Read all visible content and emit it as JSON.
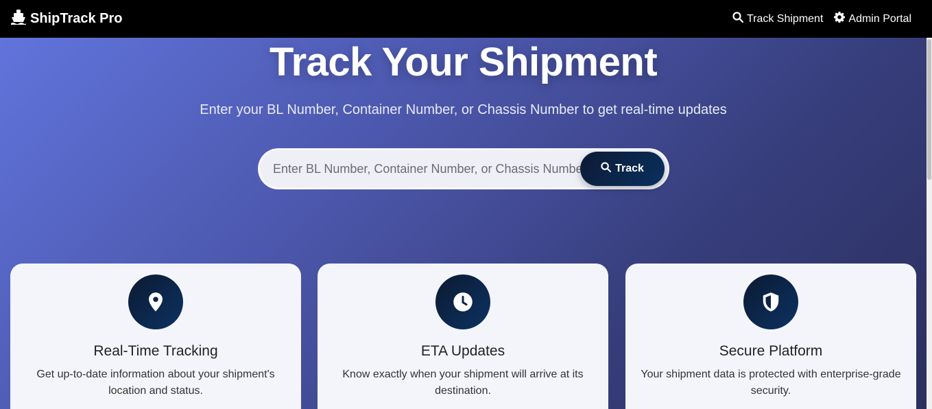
{
  "navbar": {
    "brand": "ShipTrack Pro",
    "brand_icon": "ship-icon",
    "links": [
      {
        "label": "Track Shipment",
        "icon": "search-icon"
      },
      {
        "label": "Admin Portal",
        "icon": "gear-icon"
      }
    ]
  },
  "hero": {
    "title": "Track Your Shipment",
    "subtitle": "Enter your BL Number, Container Number, or Chassis Number to get real-time updates"
  },
  "search": {
    "placeholder": "Enter BL Number, Container Number, or Chassis Number",
    "value": "",
    "button_label": "Track",
    "button_icon": "search-icon"
  },
  "features": [
    {
      "icon": "map-pin-icon",
      "title": "Real-Time Tracking",
      "description": "Get up-to-date information about your shipment's location and status."
    },
    {
      "icon": "clock-icon",
      "title": "ETA Updates",
      "description": "Know exactly when your shipment will arrive at its destination."
    },
    {
      "icon": "shield-icon",
      "title": "Secure Platform",
      "description": "Your shipment data is protected with enterprise-grade security."
    }
  ],
  "colors": {
    "navbar_bg": "#000000",
    "hero_gradient_start": "#6174dc",
    "hero_gradient_end": "#2b2f5e",
    "button_gradient_start": "#0c1a33",
    "button_gradient_end": "#0a3060",
    "card_bg": "#f4f5fa"
  }
}
